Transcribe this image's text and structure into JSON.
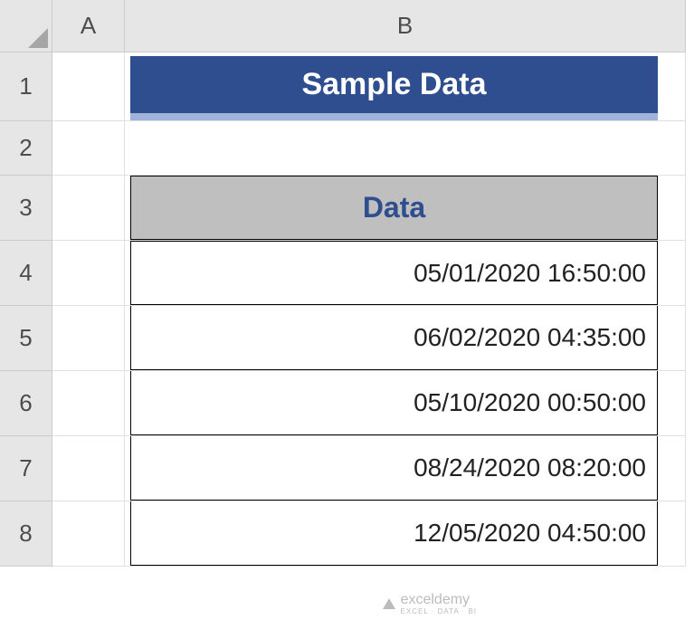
{
  "columns": [
    "A",
    "B"
  ],
  "rows": [
    "1",
    "2",
    "3",
    "4",
    "5",
    "6",
    "7",
    "8"
  ],
  "title": "Sample Data",
  "table": {
    "header": "Data",
    "rows": [
      "05/01/2020 16:50:00",
      "06/02/2020 04:35:00",
      "05/10/2020 00:50:00",
      "08/24/2020 08:20:00",
      "12/05/2020 04:50:00"
    ]
  },
  "watermark": {
    "name": "exceldemy",
    "tagline": "EXCEL · DATA · BI"
  }
}
